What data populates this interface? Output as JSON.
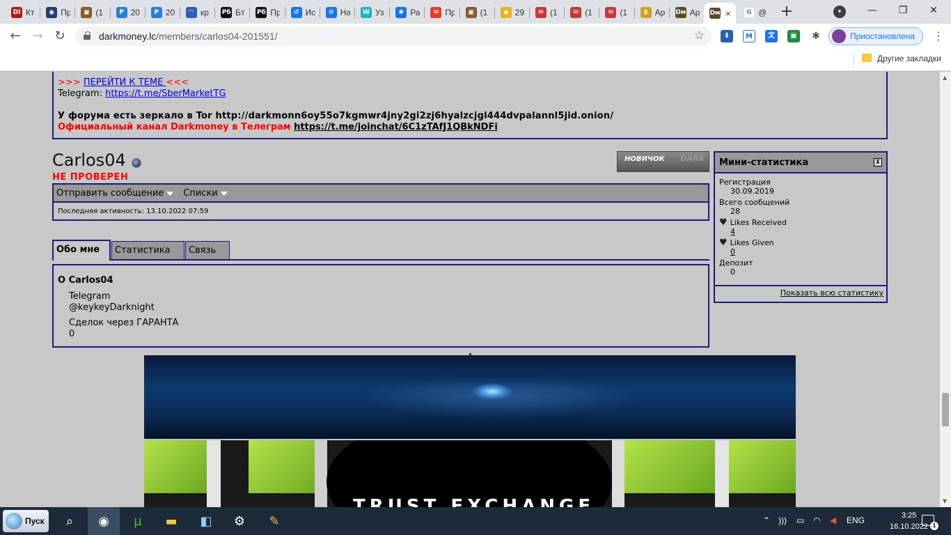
{
  "browser": {
    "tabs": [
      {
        "label": "Кт",
        "fav": "Dl",
        "color": "#b31b1b"
      },
      {
        "label": "Пр",
        "fav": "◉",
        "color": "#1f3f6e"
      },
      {
        "label": "(1",
        "fav": "▣",
        "color": "#8a5a2a"
      },
      {
        "label": "20",
        "fav": "P",
        "color": "#2a7fd4"
      },
      {
        "label": "20",
        "fav": "P",
        "color": "#2a7fd4"
      },
      {
        "label": "кр",
        "fav": "◠",
        "color": "#2a5fb4"
      },
      {
        "label": "Бт",
        "fav": "Pб",
        "color": "#111111"
      },
      {
        "label": "Пр",
        "fav": "Pб",
        "color": "#111111"
      },
      {
        "label": "Ис",
        "fav": "↺",
        "color": "#1a73e8"
      },
      {
        "label": "На",
        "fav": "⚙",
        "color": "#1a73e8"
      },
      {
        "label": "Уз",
        "fav": "W",
        "color": "#1ab6c6"
      },
      {
        "label": "Ра",
        "fav": "✱",
        "color": "#1a73e8"
      },
      {
        "label": "Пр",
        "fav": "✉",
        "color": "#e0402a"
      },
      {
        "label": "(1",
        "fav": "▣",
        "color": "#8a5a2a"
      },
      {
        "label": "29",
        "fav": "◆",
        "color": "#e8b21a"
      },
      {
        "label": "(1",
        "fav": "✉",
        "color": "#c23a3a"
      },
      {
        "label": "(1",
        "fav": "✉",
        "color": "#c23a3a"
      },
      {
        "label": "(1",
        "fav": "✉",
        "color": "#c23a3a"
      },
      {
        "label": "Ар",
        "fav": "$",
        "color": "#d4a21a"
      },
      {
        "label": "Ар",
        "fav": "Dм",
        "color": "#5a4a2a"
      }
    ],
    "active_tab": {
      "fav": "Dм",
      "close": "×"
    },
    "google_tab": {
      "label": "@",
      "fav": "G"
    },
    "new_tab": "+",
    "window": {
      "minimize": "—",
      "maximize": "❐",
      "close": "✕"
    },
    "url_host": "darkmoney.lc",
    "url_path": "/members/carlos04-201551/",
    "profile_status": "Приостановлена",
    "other_bookmarks": "Другие закладки"
  },
  "notice": {
    "goto_prefix": ">>> ",
    "goto_link": "ПЕРЕЙТИ К ТЕМЕ ",
    "goto_suffix": "<<<",
    "telegram_label": "Telegram: ",
    "telegram_link": "https://t.me/SberMarketTG",
    "mirror_text": "У форума есть зеркало в Tor http://darkmonn6oy55o7kgmwr4jny2gi2zj6hyalzcjgl444dvpalannl5jid.onion/",
    "official_text": "Официальный канал Darkmoney в Телеграм ",
    "official_link": "https://t.me/joinchat/6C1zTAfJ1QBkNDFi"
  },
  "profile": {
    "username": "Carlos04",
    "status": "НЕ ПРОВЕРЕН",
    "rank": "НОВИЧОК",
    "rank_ghost": "DARK",
    "send_message": "Отправить сообщение",
    "lists": "Списки",
    "last_activity": "Последняя активность: 13.10.2022 07:59"
  },
  "tabs": {
    "about": "Обо мне",
    "stats": "Статистика",
    "contact": "Связь"
  },
  "about": {
    "heading": "О Carlos04",
    "fields": [
      {
        "label": "Telegram",
        "value": "@keykeyDarknight"
      },
      {
        "label": "Сделок через ГАРАНТА",
        "value": "0"
      }
    ]
  },
  "mini_stats": {
    "title": "Мини-статистика",
    "toggle": "⊼",
    "registration_label": "Регистрация",
    "registration_value": "30.09.2019",
    "messages_label": "Всего сообщений",
    "messages_value": "28",
    "likes_received_label": "Likes Received",
    "likes_received_value": "4",
    "likes_given_label": "Likes Given",
    "likes_given_value": "0",
    "deposit_label": "Депозит",
    "deposit_value": "0",
    "show_all": "Показать всю статистику"
  },
  "banner": {
    "brand": "TRUST EXCHANGE"
  },
  "taskbar": {
    "start": "Пуск",
    "lang": "ENG",
    "time": "3:25",
    "date": "16.10.2022",
    "notifications": "1"
  }
}
